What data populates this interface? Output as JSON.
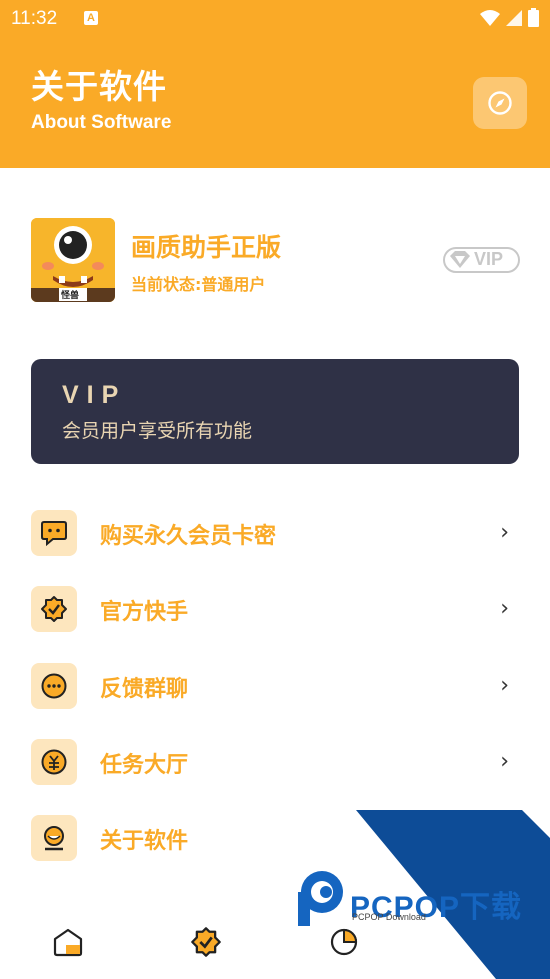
{
  "status_bar": {
    "time": "11:32",
    "notification_icon": "A"
  },
  "header": {
    "title_cn": "关于软件",
    "title_en": "About Software",
    "action_icon": "compass-icon"
  },
  "profile": {
    "app_name": "画质助手正版",
    "status_text": "当前状态:普通用户",
    "logo_tag": "怪兽",
    "badge": "VIP"
  },
  "vip_card": {
    "title": "VIP",
    "subtitle": "会员用户享受所有功能"
  },
  "menu": [
    {
      "label": "购买永久会员卡密",
      "icon": "chat-icon",
      "chevron": "›"
    },
    {
      "label": "官方快手",
      "icon": "verified-badge-icon",
      "chevron": "›"
    },
    {
      "label": "反馈群聊",
      "icon": "message-dots-icon",
      "chevron": "›"
    },
    {
      "label": "任务大厅",
      "icon": "coin-icon",
      "chevron": "›"
    },
    {
      "label": "关于软件",
      "icon": "info-icon",
      "chevron": ""
    }
  ],
  "tabs": [
    {
      "name": "home",
      "icon": "home-icon"
    },
    {
      "name": "verified",
      "icon": "verified-badge-icon"
    },
    {
      "name": "stats",
      "icon": "pie-chart-icon"
    }
  ],
  "watermark": {
    "brand": "PCPOP下载",
    "sub": "PCPOP Download"
  },
  "colors": {
    "accent": "#FAAA27",
    "card": "#2F3146",
    "icon_bg": "#FDE6BE",
    "vip_text": "#E9D5B2"
  }
}
